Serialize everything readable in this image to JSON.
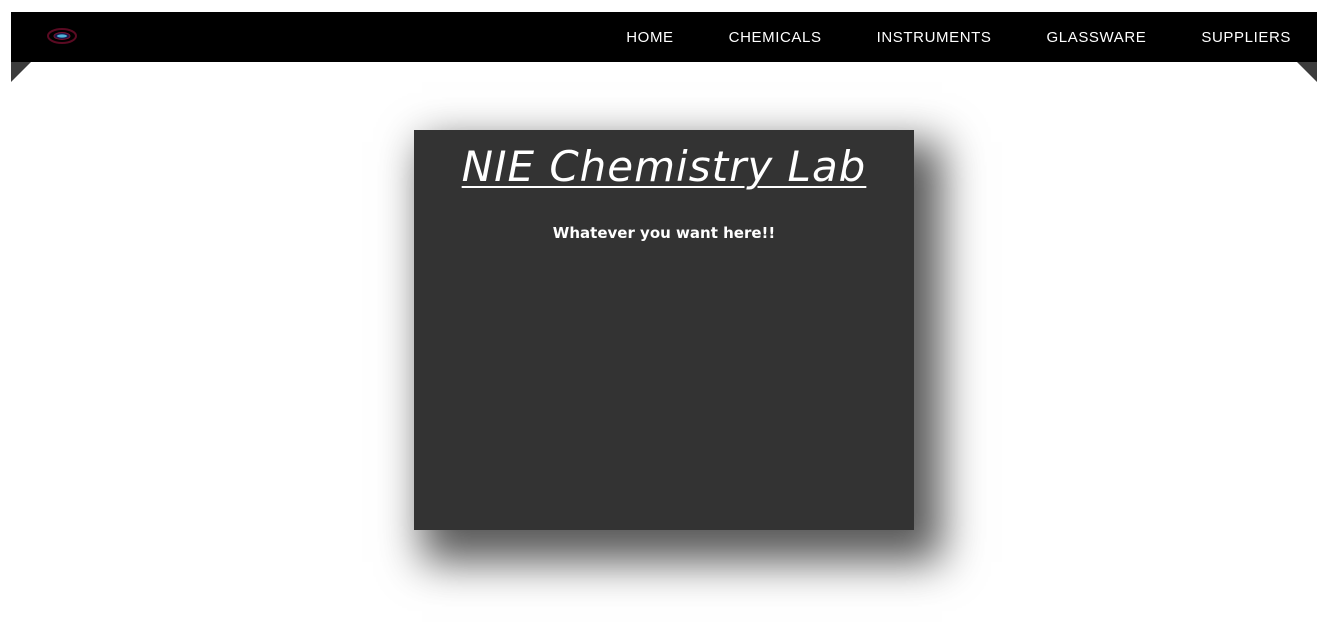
{
  "nav": {
    "logo_icon": "chemistry-logo-icon",
    "items": [
      {
        "label": "HOME"
      },
      {
        "label": "CHEMICALS"
      },
      {
        "label": "INSTRUMENTS"
      },
      {
        "label": "GLASSWARE"
      },
      {
        "label": "SUPPLIERS"
      }
    ]
  },
  "card": {
    "title": "NIE Chemistry Lab",
    "subtitle": "Whatever you want here!!"
  },
  "colors": {
    "navbar_bg": "#000000",
    "ribbon": "#3c3c3c",
    "card_bg": "#333333",
    "text": "#ffffff",
    "page_bg": "#ffffff"
  }
}
